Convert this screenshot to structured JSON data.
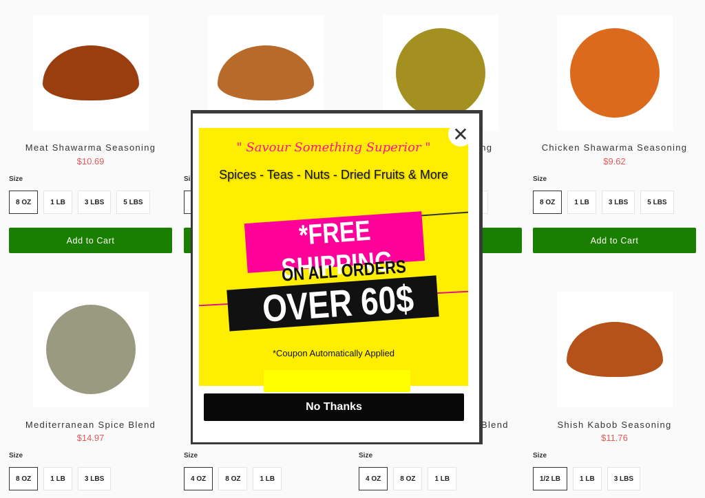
{
  "products": [
    {
      "name": "Meat Shawarma Seasoning",
      "price": "$10.69",
      "size_label": "Size",
      "sizes": [
        "8 OZ",
        "1 LB",
        "3 LBS",
        "5 LBS"
      ],
      "cart": "Add to Cart",
      "color": "#9a3e10"
    },
    {
      "name": "",
      "price": "",
      "size_label": "Size",
      "sizes": [],
      "cart": "",
      "color": "#b76a2a"
    },
    {
      "name": "ing",
      "price": "",
      "size_label": "",
      "sizes": [],
      "cart": "",
      "color": "#a39020"
    },
    {
      "name": "Chicken Shawarma Seasoning",
      "price": "$9.62",
      "size_label": "Size",
      "sizes": [
        "8 OZ",
        "1 LB",
        "3 LBS",
        "5 LBS"
      ],
      "cart": "Add to Cart",
      "color": "#dc6a1c"
    },
    {
      "name": "Mediterranean Spice Blend",
      "price": "$14.97",
      "size_label": "Size",
      "sizes": [
        "8 OZ",
        "1 LB",
        "3 LBS"
      ],
      "color": "#9a9a80"
    },
    {
      "name": "",
      "price": "",
      "size_label": "Size",
      "sizes": [
        "4 OZ",
        "8 OZ",
        "1 LB"
      ]
    },
    {
      "name": "Blend",
      "price": "",
      "size_label": "Size",
      "sizes": [
        "4 OZ",
        "8 OZ",
        "1 LB"
      ]
    },
    {
      "name": "Shish Kabob Seasoning",
      "price": "$11.76",
      "size_label": "Size",
      "sizes": [
        "1/2 LB",
        "1 LB",
        "3 LBS"
      ],
      "color": "#b5521a"
    }
  ],
  "popup": {
    "headline": "\" Savour Something Superior \"",
    "tagline": "Spices - Teas - Nuts - Dried Fruits & More",
    "free_shipping": "*FREE SHIPPING",
    "on_all_orders": "ON ALL ORDERS",
    "over": "OVER 60$",
    "coupon": "*Coupon Automatically Applied",
    "no_thanks": "No Thanks",
    "close_icon": "close-icon",
    "colors": {
      "banner": "#ffee00",
      "pink": "#ff0099",
      "button": "#080808"
    }
  },
  "colors": {
    "cart": "#1a7f00",
    "price": "#e05a5a"
  }
}
